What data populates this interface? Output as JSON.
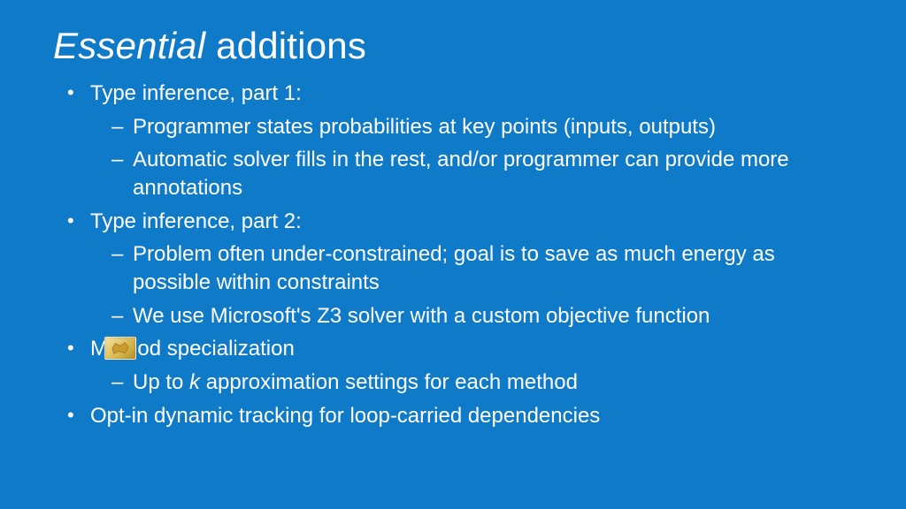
{
  "title": {
    "em": "Essential",
    "rest": " additions"
  },
  "bullets": [
    {
      "text": "Type inference, part 1:",
      "sub": [
        "Programmer states probabilities at key points (inputs, outputs)",
        "Automatic solver fills in the rest, and/or programmer can provide more annotations"
      ]
    },
    {
      "text": "Type inference, part 2:",
      "sub": [
        "Problem often under-constrained; goal is to save as much energy as possible within constraints",
        "We use Microsoft's Z3 solver with a custom objective function"
      ]
    },
    {
      "text": "Method specialization",
      "sub_html": [
        {
          "pre": "Up to ",
          "k": "k",
          "post": " approximation settings for each method"
        }
      ],
      "badge": true
    },
    {
      "text": "Opt-in dynamic tracking for loop-carried dependencies",
      "sub": []
    }
  ]
}
